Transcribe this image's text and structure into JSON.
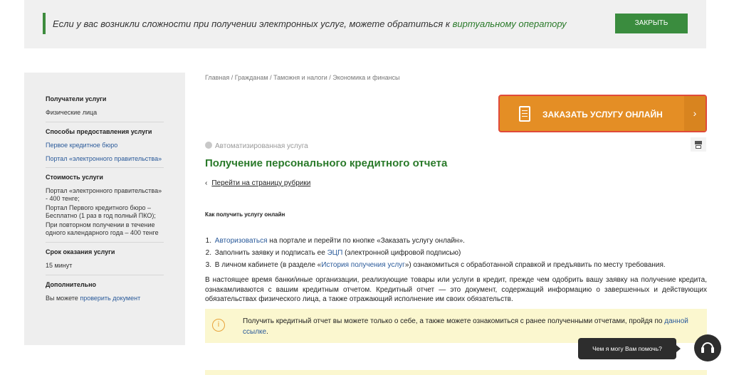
{
  "notice": {
    "text": "Если у вас возникли сложности при получении электронных услуг, можете обратиться к ",
    "link": "виртуальному оператору",
    "close_label": "ЗАКРЫТЬ"
  },
  "sidebar": {
    "recipients_title": "Получатели услуги",
    "recipients_value": "Физические лица",
    "methods_title": "Способы предоставления услуги",
    "methods": [
      "Первое кредитное бюро",
      "Портал «электронного правительства»"
    ],
    "cost_title": "Стоимость услуги",
    "cost_lines": [
      "Портал «электронного правительства» - 400 тенге;",
      "Портал Первого кредитного бюро – Бесплатно (1 раз в год полный ПКО);",
      "При повторном получении в течение одного календарного года – 400 тенге"
    ],
    "term_title": "Срок оказания услуги",
    "term_value": "15 минут",
    "extra_title": "Дополнительно",
    "extra_text": "Вы можете ",
    "extra_link": "проверить документ"
  },
  "breadcrumbs": "Главная  /  Гражданам  /  Таможня и налоги  /  Экономика и финансы",
  "order_button": "ЗАКАЗАТЬ УСЛУГУ ОНЛАЙН",
  "service_type": "Автоматизированная услуга",
  "title": "Получение персонального кредитного отчета",
  "back_link": "Перейти на страницу рубрики",
  "howto_title": "Как получить услугу онлайн",
  "steps": [
    {
      "num": "1.",
      "link": "Авторизоваться",
      "text": " на портале и перейти по кнопке «Заказать услугу онлайн»."
    },
    {
      "num": "2.",
      "pre": "Заполнить заявку и подписать ее ",
      "link": "ЭЦП",
      "text": " (электронной цифровой подписью)"
    },
    {
      "num": "3.",
      "pre": "В личном кабинете (в разделе «",
      "link": "История получения услуг",
      "text": "») ознакомиться с обработанной справкой и предъявить по месту требования."
    }
  ],
  "paragraph": "В настоящее время банки/иные организации, реализующие товары или услуги в кредит, прежде чем одобрить вашу заявку на получение кредита, ознакамливаются с вашим кредитным отчетом. Кредитный отчет — это документ, содержащий информацию о завершенных и действующих обязательствах физического лица, а также отражающий исполнение им своих обязательств.",
  "warning": {
    "icon": "i",
    "text": "Получить кредитный отчет вы можете только о себе, а также можете ознакомиться с ранее полученными отчетами, пройдя по ",
    "link": "данной ссылке",
    "end": "."
  },
  "help_text": "Чем я могу Вам помочь?",
  "colors": {
    "green": "#3a8c3e",
    "orange": "#e48e25",
    "warn_bg": "#fbf7cf"
  }
}
